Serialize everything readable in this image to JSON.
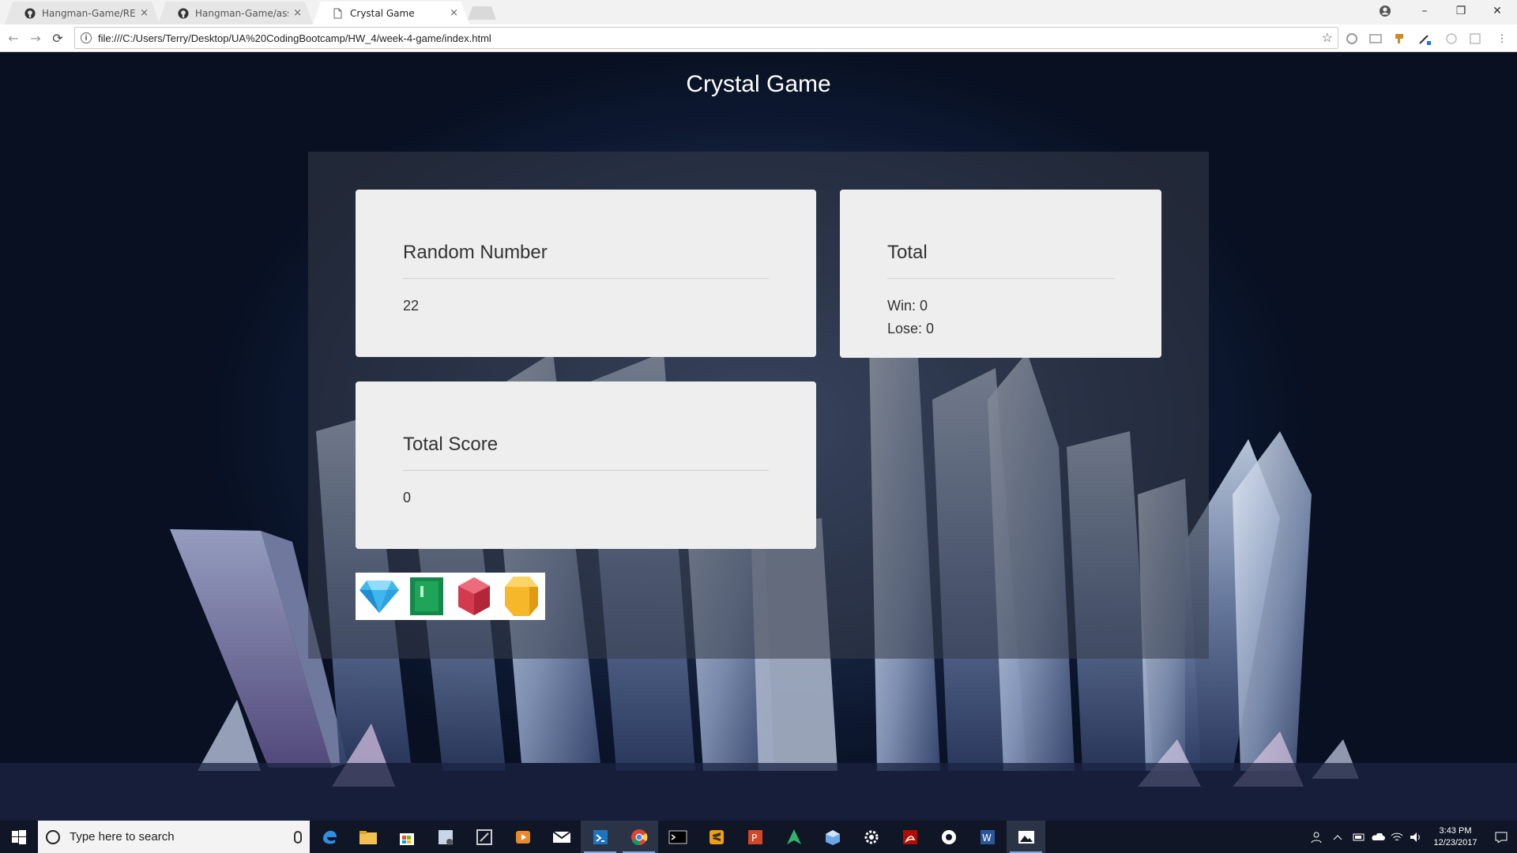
{
  "browser": {
    "tabs": [
      {
        "title": "Hangman-Game/READM",
        "icon": "github-icon",
        "close": "×"
      },
      {
        "title": "Hangman-Game/assets/",
        "icon": "github-icon",
        "close": "×"
      },
      {
        "title": "Crystal Game",
        "icon": "page-icon",
        "close": "×"
      }
    ],
    "window_controls": {
      "minimize": "–",
      "restore": "❐",
      "close": "✕"
    },
    "address": "file:///C:/Users/Terry/Desktop/UA%20CodingBootcamp/HW_4/week-4-game/index.html",
    "nav": {
      "back": "←",
      "forward": "→",
      "reload": "⟳",
      "info": "i",
      "star": "☆",
      "menu": "⋮"
    }
  },
  "page": {
    "title": "Crystal Game",
    "random_card": {
      "heading": "Random Number",
      "value": "22"
    },
    "total_card": {
      "heading": "Total",
      "win": "Win: 0",
      "lose": "Lose: 0"
    },
    "score_card": {
      "heading": "Total Score",
      "value": "0"
    },
    "crystals": [
      {
        "name": "blue-diamond",
        "color": "#3fb6ec"
      },
      {
        "name": "green-emerald",
        "color": "#1ea55a"
      },
      {
        "name": "red-ruby",
        "color": "#d43a4e"
      },
      {
        "name": "yellow-topaz",
        "color": "#f6b82a"
      }
    ]
  },
  "taskbar": {
    "search_placeholder": "Type here to search",
    "time": "3:43 PM",
    "date": "12/23/2017",
    "accent": "#101626"
  }
}
